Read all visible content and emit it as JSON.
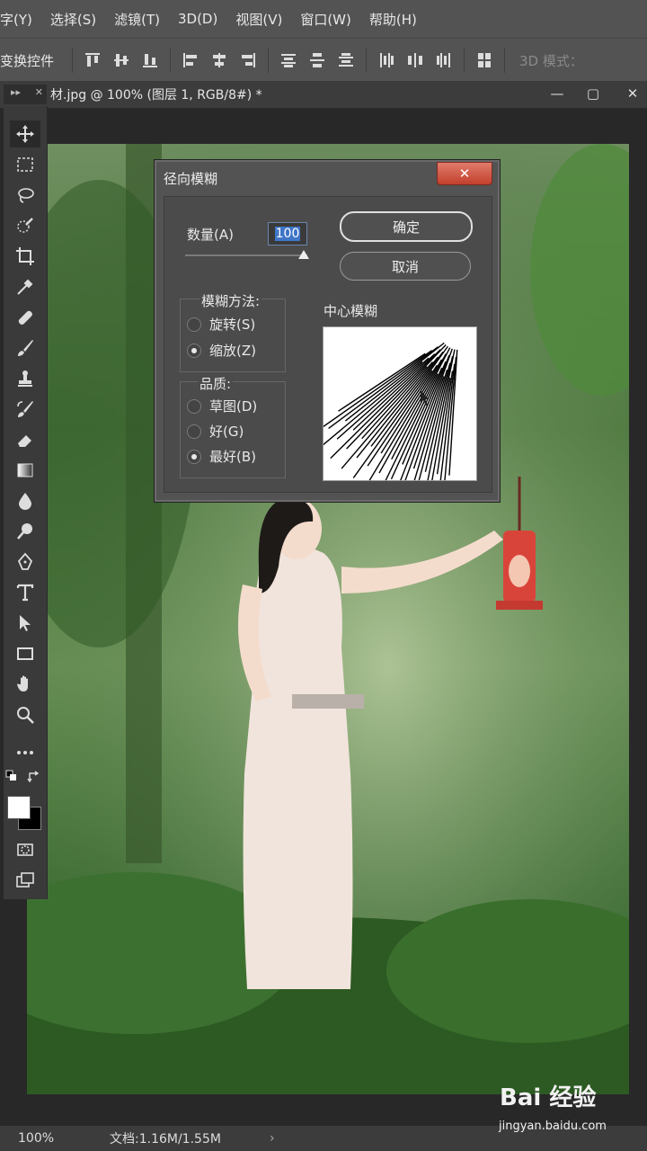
{
  "menu": [
    "字(Y)",
    "选择(S)",
    "滤镜(T)",
    "3D(D)",
    "视图(V)",
    "窗口(W)",
    "帮助(H)"
  ],
  "options_bar": {
    "label": "变换控件",
    "mode_label": "3D 模式："
  },
  "document": {
    "tab_title": "材.jpg @ 100% (图层 1, RGB/8#) *"
  },
  "status": {
    "zoom": "100%",
    "doc_size": "文档:1.16M/1.55M"
  },
  "dialog": {
    "title": "径向模糊",
    "close": "✕",
    "amount_label": "数量(A)",
    "amount_value": "100",
    "amount_fraction": 1.0,
    "ok_label": "确定",
    "cancel_label": "取消",
    "blur_method": {
      "title": "模糊方法:",
      "options": [
        {
          "label": "旋转(S)",
          "selected": false
        },
        {
          "label": "缩放(Z)",
          "selected": true
        }
      ]
    },
    "quality": {
      "title": "品质:",
      "options": [
        {
          "label": "草图(D)",
          "selected": false
        },
        {
          "label": "好(G)",
          "selected": false
        },
        {
          "label": "最好(B)",
          "selected": true
        }
      ]
    },
    "center_label": "中心模糊"
  },
  "tools": [
    "move-icon",
    "marquee-icon",
    "lasso-icon",
    "quick-select-icon",
    "crop-icon",
    "eyedropper-icon",
    "healing-icon",
    "brush-icon",
    "stamp-icon",
    "history-brush-icon",
    "eraser-icon",
    "gradient-icon",
    "blur-icon",
    "dodge-icon",
    "pen-icon",
    "type-icon",
    "path-select-icon",
    "rectangle-icon",
    "hand-icon",
    "zoom-icon",
    "more-icon"
  ],
  "colors": {
    "foreground": "#ffffff",
    "background": "#000000",
    "close_button": "#c8442f"
  },
  "watermark": {
    "brand": "Bai 经验",
    "url": "jingyan.baidu.com"
  }
}
